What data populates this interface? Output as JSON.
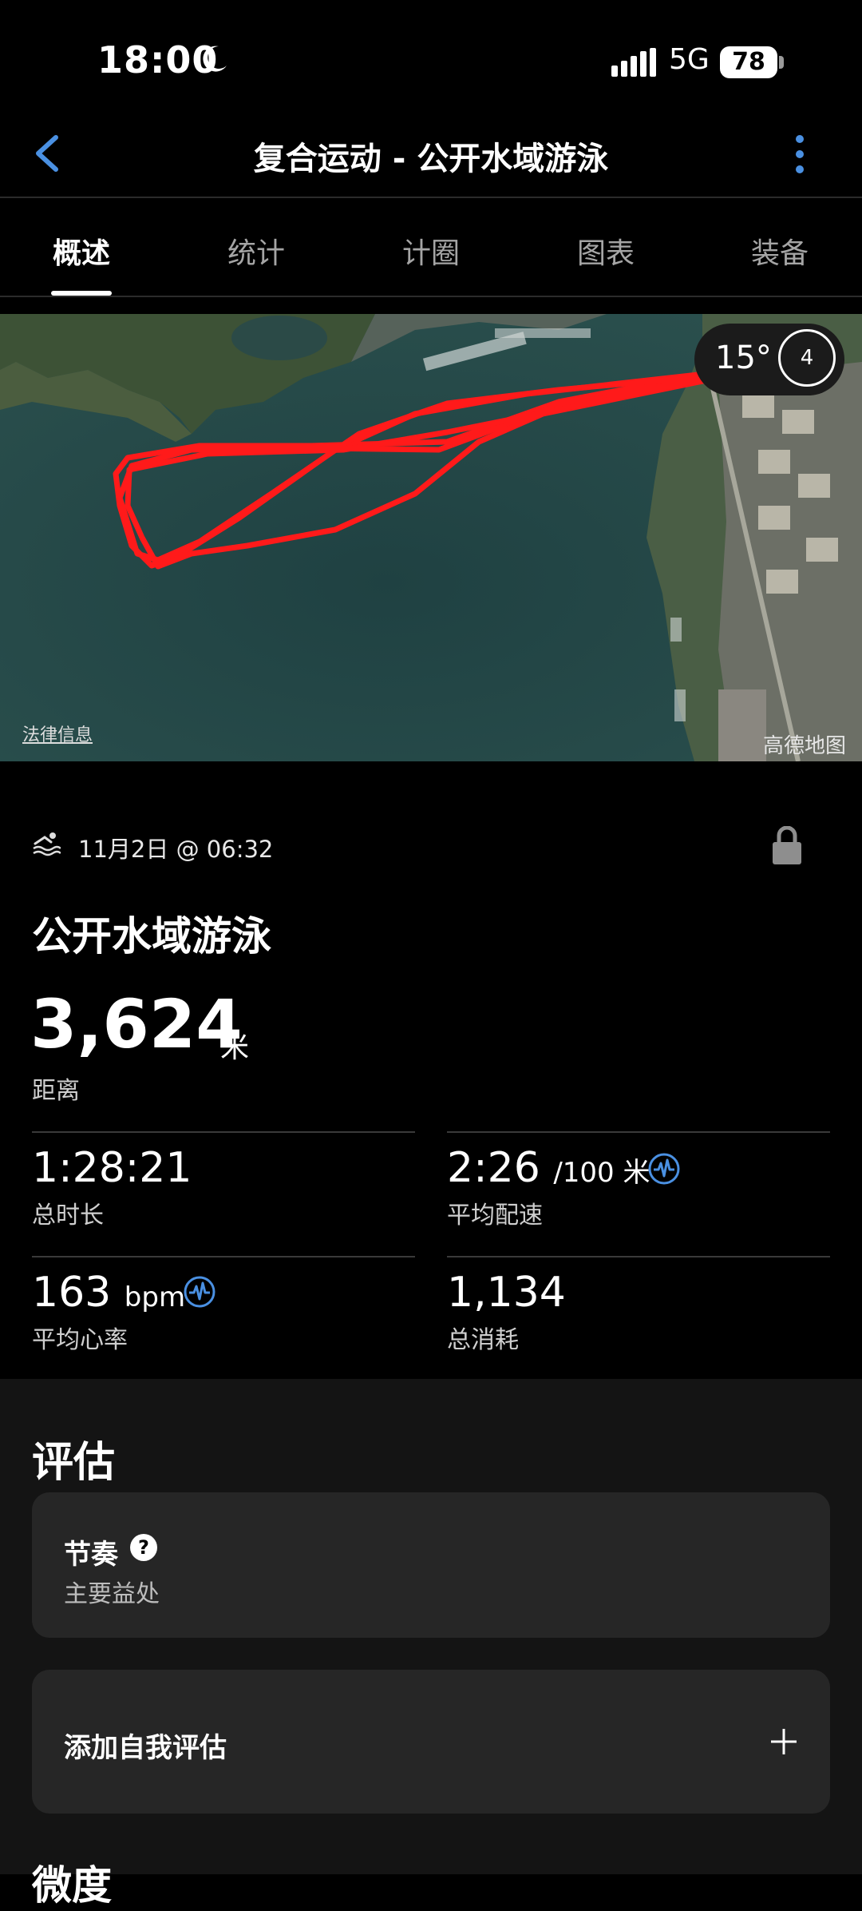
{
  "status_bar": {
    "time": "18:00",
    "network": "5G",
    "battery": "78"
  },
  "header": {
    "title": "复合运动 - 公开水域游泳"
  },
  "tabs": [
    "概述",
    "统计",
    "计圈",
    "图表",
    "装备"
  ],
  "map": {
    "weather_temp": "15°",
    "wind": "4",
    "legal_link": "法律信息",
    "provider": "高德地图"
  },
  "activity": {
    "date": "11月2日 @ 06:32",
    "title": "公开水域游泳",
    "distance": {
      "value": "3,624",
      "unit": "米",
      "label": "距离"
    },
    "stats": {
      "total_time": {
        "value": "1:28:21",
        "label": "总时长"
      },
      "avg_pace": {
        "value": "2:26",
        "unit": "/100 米",
        "label": "平均配速"
      },
      "avg_hr": {
        "value": "163",
        "unit": "bpm",
        "label": "平均心率"
      },
      "calories": {
        "value": "1,134",
        "label": "总消耗"
      }
    }
  },
  "evaluation": {
    "heading": "评估",
    "rhythm_title": "节奏",
    "rhythm_help": "?",
    "rhythm_sub": "主要益处",
    "add_self": "添加自我评估",
    "next_heading": "微度"
  },
  "colors": {
    "accent": "#4a90e2",
    "route": "#ff1a1a",
    "background": "#000000"
  }
}
